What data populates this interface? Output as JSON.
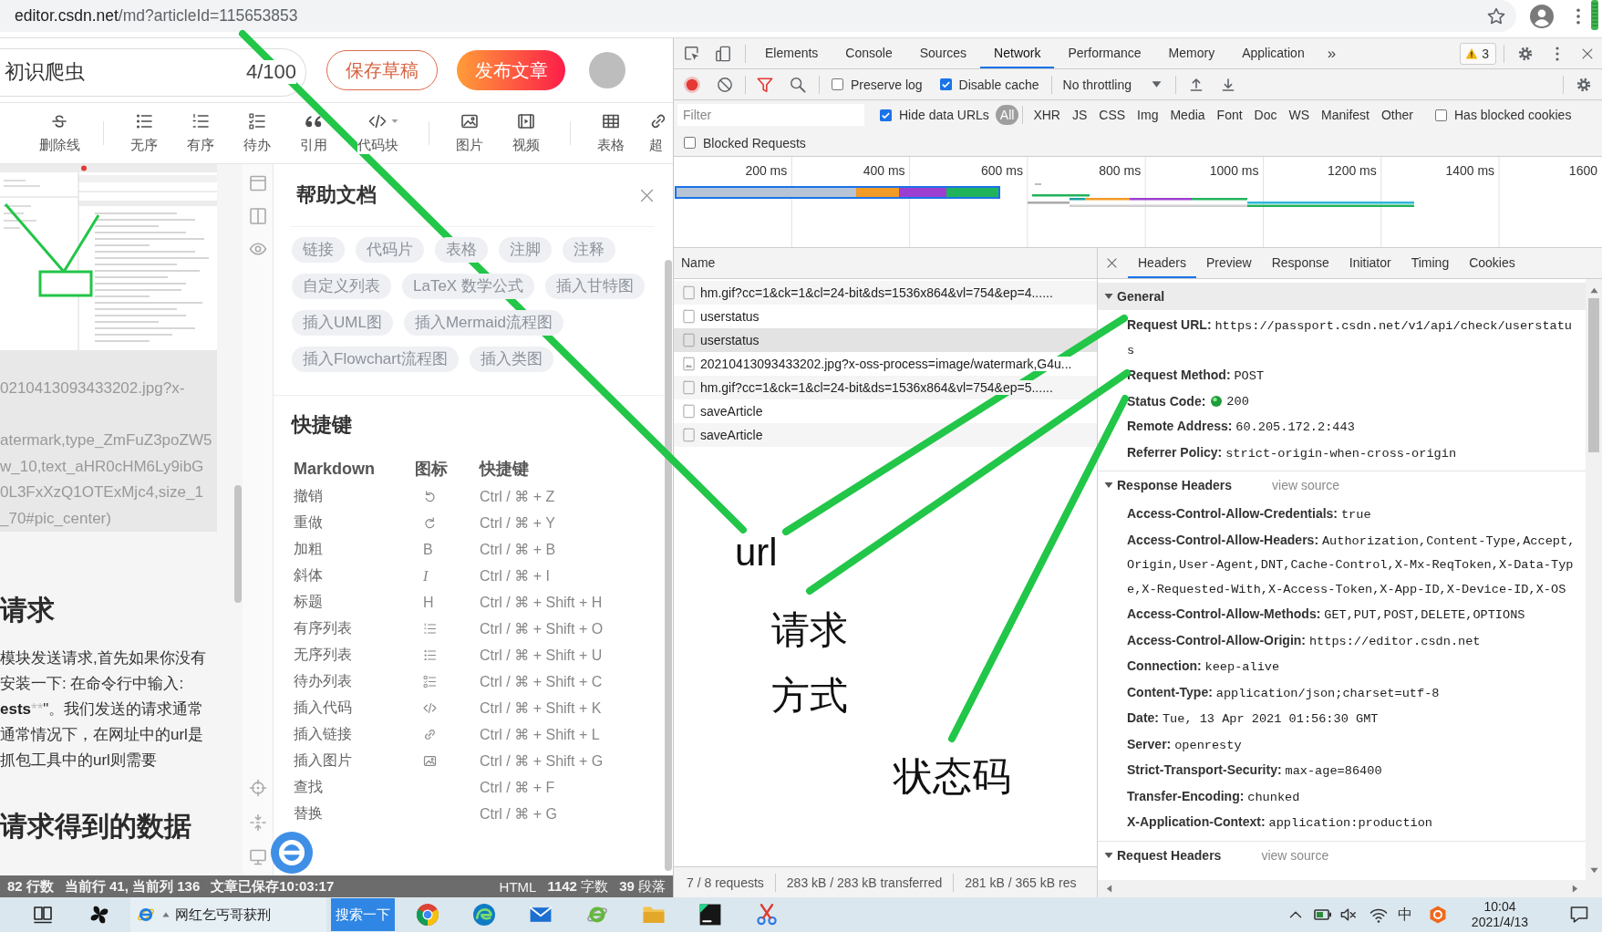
{
  "browser": {
    "url": {
      "host": "editor.csdn.net",
      "path": "/md?articleId=115653853"
    }
  },
  "editor": {
    "title": "初识爬虫",
    "title_count": "4/100",
    "actions": [
      {
        "label": "保存草稿",
        "kind": "outline"
      },
      {
        "label": "发布文章",
        "kind": "primary"
      }
    ],
    "toolbar": [
      [
        {
          "label": "删除线",
          "kind": "strike",
          "dropdown": false
        }
      ],
      [
        {
          "label": "无序",
          "kind": "ul",
          "dropdown": false
        },
        {
          "label": "有序",
          "kind": "ol",
          "dropdown": false
        },
        {
          "label": "待办",
          "kind": "todo",
          "dropdown": false
        },
        {
          "label": "引用",
          "kind": "quote",
          "dropdown": false
        },
        {
          "label": "代码块",
          "kind": "code",
          "dropdown": true
        }
      ],
      [
        {
          "label": "图片",
          "kind": "image",
          "dropdown": false
        },
        {
          "label": "视频",
          "kind": "video",
          "dropdown": false
        }
      ],
      [
        {
          "label": "表格",
          "kind": "table",
          "dropdown": false
        },
        {
          "label": "超",
          "kind": "link",
          "dropdown": false
        }
      ]
    ],
    "source": {
      "image_lines": [
        "0210413093433202.jpg?x-",
        "atermark,type_ZmFuZ3poZW5",
        "w_10,text_aHR0cHM6Ly9ibG",
        "0L3FxXzQ1OTExMjc4,size_1",
        "_70#pic_center)"
      ],
      "heading_1": "请求",
      "paragraph_lines": [
        [
          {
            "text": "模块发送请求,首先如果你没有",
            "kind": "plain"
          }
        ],
        [
          {
            "text": "安装一下: 在命令行中输入:",
            "kind": "plain"
          }
        ],
        [
          {
            "text": "ests",
            "kind": "bold"
          },
          {
            "text": "**",
            "kind": "syntax"
          },
          {
            "text": "\"。我们发送的请求通常",
            "kind": "plain"
          }
        ],
        [
          {
            "text": "通常情况下，在网址中的url是",
            "kind": "plain"
          }
        ],
        [
          {
            "text": "抓包工具中的url则需要",
            "kind": "plain"
          }
        ]
      ],
      "heading_2": "请求得到的数据"
    },
    "status_bar": {
      "left": [
        "82 行数",
        "当前行 41, 当前列 136",
        "文章已保存10:03:17"
      ],
      "right": [
        "HTML",
        "**1142** 字数",
        "**39** 段落"
      ]
    }
  },
  "help": {
    "title": "帮助文档",
    "tags": [
      "链接",
      "代码片",
      "表格",
      "注脚",
      "注释",
      "自定义列表",
      "LaTeX 数学公式",
      "插入甘特图",
      "插入UML图",
      "插入Mermaid流程图",
      "插入Flowchart流程图",
      "插入类图"
    ],
    "shortcuts_title": "快捷键",
    "columns": [
      "Markdown",
      "图标",
      "快捷键"
    ],
    "shortcuts": [
      {
        "name": "撤销",
        "kind": "undo",
        "keys": "Ctrl / ⌘ + Z"
      },
      {
        "name": "重做",
        "kind": "redo",
        "keys": "Ctrl / ⌘ + Y"
      },
      {
        "name": "加粗",
        "kind": "glyph",
        "glyph": "B",
        "keys": "Ctrl / ⌘ + B"
      },
      {
        "name": "斜体",
        "kind": "italic",
        "glyph": "I",
        "keys": "Ctrl / ⌘ + I"
      },
      {
        "name": "标题",
        "kind": "glyph",
        "glyph": "H",
        "keys": "Ctrl / ⌘ + Shift + H"
      },
      {
        "name": "有序列表",
        "kind": "ol",
        "keys": "Ctrl / ⌘ + Shift + O"
      },
      {
        "name": "无序列表",
        "kind": "ul",
        "keys": "Ctrl / ⌘ + Shift + U"
      },
      {
        "name": "待办列表",
        "kind": "todo",
        "keys": "Ctrl / ⌘ + Shift + C"
      },
      {
        "name": "插入代码",
        "kind": "code",
        "keys": "Ctrl / ⌘ + Shift + K"
      },
      {
        "name": "插入链接",
        "kind": "link",
        "keys": "Ctrl / ⌘ + Shift + L"
      },
      {
        "name": "插入图片",
        "kind": "image",
        "keys": "Ctrl / ⌘ + Shift + G"
      },
      {
        "name": "查找",
        "kind": "none",
        "keys": "Ctrl / ⌘ + F"
      },
      {
        "name": "替换",
        "kind": "none",
        "keys": "Ctrl / ⌘ + G"
      }
    ]
  },
  "devtools": {
    "tabs": [
      {
        "label": "Elements",
        "selected": false
      },
      {
        "label": "Console",
        "selected": false
      },
      {
        "label": "Sources",
        "selected": false
      },
      {
        "label": "Network",
        "selected": true
      },
      {
        "label": "Performance",
        "selected": false
      },
      {
        "label": "Memory",
        "selected": false
      },
      {
        "label": "Application",
        "selected": false
      }
    ],
    "more_tabs": "»",
    "warning_count": "3",
    "toolbar": {
      "recording": true,
      "preserve_log": {
        "label": "Preserve log",
        "checked": false
      },
      "disable_cache": {
        "label": "Disable cache",
        "checked": true
      },
      "throttling": "No throttling"
    },
    "filter": {
      "placeholder": "Filter",
      "hide_data_urls": {
        "label": "Hide data URLs",
        "checked": true
      },
      "types": [
        {
          "label": "All",
          "selected": true
        },
        {
          "label": "XHR",
          "selected": false
        },
        {
          "label": "JS",
          "selected": false
        },
        {
          "label": "CSS",
          "selected": false
        },
        {
          "label": "Img",
          "selected": false
        },
        {
          "label": "Media",
          "selected": false
        },
        {
          "label": "Font",
          "selected": false
        },
        {
          "label": "Doc",
          "selected": false
        },
        {
          "label": "WS",
          "selected": false
        },
        {
          "label": "Manifest",
          "selected": false
        },
        {
          "label": "Other",
          "selected": false
        }
      ],
      "has_blocked_cookies": {
        "label": "Has blocked cookies",
        "checked": false
      },
      "blocked_requests": {
        "label": "Blocked Requests",
        "checked": false
      }
    },
    "timeline": {
      "ticks": [
        "200 ms",
        "400 ms",
        "600 ms",
        "800 ms",
        "1000 ms",
        "1200 ms",
        "1400 ms",
        "1600"
      ]
    },
    "requests": {
      "column": "Name",
      "rows": [
        {
          "name": "hm.gif?cc=1&ck=1&cl=24-bit&ds=1536x864&vl=754&ep=4......",
          "kind": "document",
          "selected": false
        },
        {
          "name": "userstatus",
          "kind": "document",
          "selected": false
        },
        {
          "name": "userstatus",
          "kind": "document",
          "selected": true
        },
        {
          "name": "20210413093433202.jpg?x-oss-process=image/watermark,G4u...",
          "kind": "image",
          "selected": false
        },
        {
          "name": "hm.gif?cc=1&ck=1&cl=24-bit&ds=1536x864&vl=754&ep=5......",
          "kind": "document",
          "selected": false
        },
        {
          "name": "saveArticle",
          "kind": "document",
          "selected": false
        },
        {
          "name": "saveArticle",
          "kind": "document",
          "selected": false
        }
      ],
      "summary": [
        "7 / 8 requests",
        "283 kB / 283 kB transferred",
        "281 kB / 365 kB res"
      ]
    },
    "details": {
      "tabs": [
        {
          "label": "Headers",
          "selected": true
        },
        {
          "label": "Preview",
          "selected": false
        },
        {
          "label": "Response",
          "selected": false
        },
        {
          "label": "Initiator",
          "selected": false
        },
        {
          "label": "Timing",
          "selected": false
        },
        {
          "label": "Cookies",
          "selected": false
        }
      ],
      "sections": [
        {
          "title": "General",
          "expanded": true,
          "selected": true,
          "rows": [
            {
              "key": "Request URL:",
              "value": "https://passport.csdn.net/v1/api/check/userstatus",
              "kind": "plain"
            },
            {
              "key": "Request Method:",
              "value": "POST",
              "kind": "plain"
            },
            {
              "key": "Status Code:",
              "value": "200",
              "kind": "status"
            },
            {
              "key": "Remote Address:",
              "value": "60.205.172.2:443",
              "kind": "plain"
            },
            {
              "key": "Referrer Policy:",
              "value": "strict-origin-when-cross-origin",
              "kind": "plain"
            }
          ]
        },
        {
          "title": "Response Headers",
          "expanded": true,
          "selected": false,
          "link": "view source",
          "rows": [
            {
              "key": "Access-Control-Allow-Credentials:",
              "value": "true"
            },
            {
              "key": "Access-Control-Allow-Headers:",
              "value": "Authorization,Content-Type,Accept,Origin,User-Agent,DNT,Cache-Control,X-Mx-ReqToken,X-Data-Type,X-Requested-With,X-Access-Token,X-App-ID,X-Device-ID,X-OS"
            },
            {
              "key": "Access-Control-Allow-Methods:",
              "value": "GET,PUT,POST,DELETE,OPTIONS"
            },
            {
              "key": "Access-Control-Allow-Origin:",
              "value": "https://editor.csdn.net"
            },
            {
              "key": "Connection:",
              "value": "keep-alive"
            },
            {
              "key": "Content-Type:",
              "value": "application/json;charset=utf-8"
            },
            {
              "key": "Date:",
              "value": "Tue, 13 Apr 2021 01:56:30 GMT"
            },
            {
              "key": "Server:",
              "value": "openresty"
            },
            {
              "key": "Strict-Transport-Security:",
              "value": "max-age=86400"
            },
            {
              "key": "Transfer-Encoding:",
              "value": "chunked"
            },
            {
              "key": "X-Application-Context:",
              "value": "application:production"
            }
          ]
        },
        {
          "title": "Request Headers",
          "expanded": true,
          "selected": false,
          "link": "view source"
        }
      ]
    }
  },
  "annotations": [
    {
      "label": "url"
    },
    {
      "label": "请求方式"
    },
    {
      "label": "状态码"
    }
  ],
  "taskbar": {
    "task_title": "网红乞丐哥获刑",
    "search_button": "搜索一下",
    "input_method": "中",
    "time": "10:04",
    "date": "2021/4/13"
  }
}
